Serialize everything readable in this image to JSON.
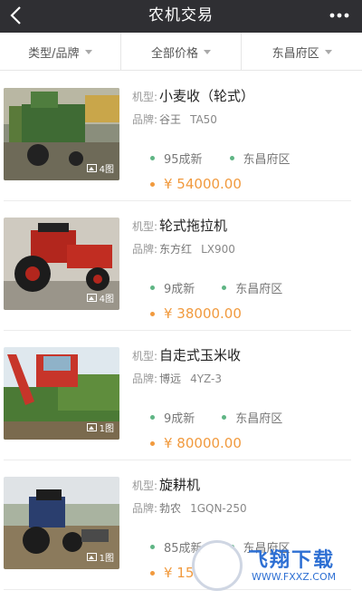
{
  "header": {
    "title": "农机交易",
    "back_icon": "back-arrow-icon",
    "more_icon": "more-dots-icon"
  },
  "filters": [
    {
      "label": "类型/品牌"
    },
    {
      "label": "全部价格"
    },
    {
      "label": "东昌府区"
    }
  ],
  "labels": {
    "type_prefix": "机型:",
    "brand_prefix": "品牌:"
  },
  "listings": [
    {
      "type": "小麦收（轮式）",
      "brand": "谷王",
      "model": "TA50",
      "condition": "95成新",
      "district": "东昌府区",
      "price": "¥ 54000.00",
      "photo_count": "4图"
    },
    {
      "type": "轮式拖拉机",
      "brand": "东方红",
      "model": "LX900",
      "condition": "9成新",
      "district": "东昌府区",
      "price": "¥ 38000.00",
      "photo_count": "4图"
    },
    {
      "type": "自走式玉米收",
      "brand": "博远",
      "model": "4YZ-3",
      "condition": "9成新",
      "district": "东昌府区",
      "price": "¥ 80000.00",
      "photo_count": "1图"
    },
    {
      "type": "旋耕机",
      "brand": "勃农",
      "model": "1GQN-250",
      "condition": "85成新",
      "district": "东昌府区",
      "price": "¥ 15",
      "photo_count": "1图"
    }
  ],
  "watermark": {
    "title": "飞翔下载",
    "url": "WWW.FXXZ.COM"
  },
  "colors": {
    "topbar": "#2f2f33",
    "price": "#f19a3e",
    "tag_dot": "#5fb584"
  }
}
